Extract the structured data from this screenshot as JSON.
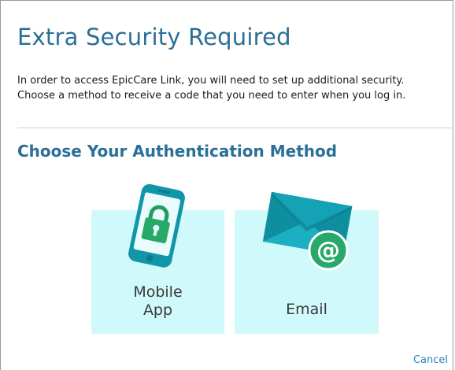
{
  "dialog": {
    "title": "Extra Security Required",
    "intro": "In order to access EpicCare Link, you will need to set up additional security. Choose a method to receive a code that you need to enter when you log in.",
    "subtitle": "Choose Your Authentication Method"
  },
  "methods": [
    {
      "label": "Mobile\nApp",
      "icon": "mobile-lock-icon"
    },
    {
      "label": "Email",
      "icon": "envelope-at-icon"
    }
  ],
  "footer": {
    "cancel_label": "Cancel"
  },
  "colors": {
    "heading": "#2a6f97",
    "card_background": "#cff9fa",
    "icon_teal": "#17a9b8",
    "lock_green": "#27a96a",
    "link": "#2a86b5"
  }
}
